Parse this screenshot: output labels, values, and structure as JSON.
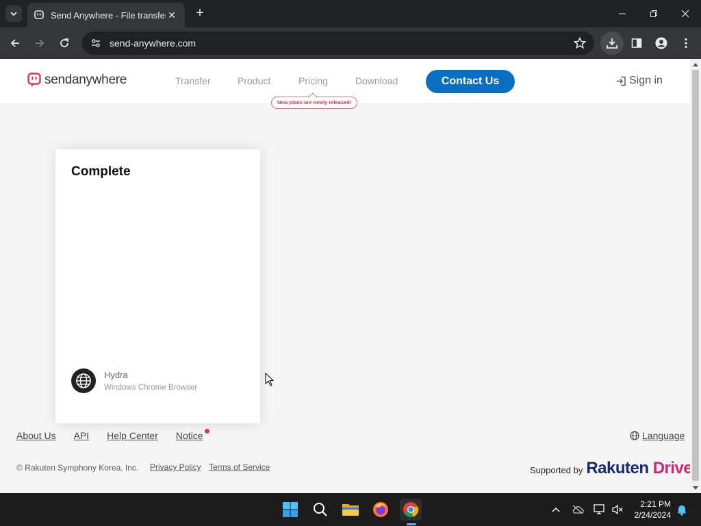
{
  "browser": {
    "tab_title": "Send Anywhere - File transfer",
    "url": "send-anywhere.com"
  },
  "header": {
    "logo_text_bold": "send",
    "logo_text_rest": "anywhere",
    "nav": [
      "Transfer",
      "Product",
      "Pricing",
      "Download"
    ],
    "new_plans_badge": "New plans are newly released!",
    "contact_label": "Contact Us",
    "signin_label": "Sign in"
  },
  "card": {
    "title": "Complete",
    "device_name": "Hydra",
    "device_desc": "Windows Chrome Browser"
  },
  "footer": {
    "links": [
      "About Us",
      "API",
      "Help Center",
      "Notice"
    ],
    "language_label": "Language",
    "copyright": "© Rakuten Symphony Korea, Inc.",
    "privacy": "Privacy Policy",
    "terms": "Terms of Service",
    "supported_by": "Supported by",
    "brand_main": "Rakuten ",
    "brand_accent": "Drive"
  },
  "taskbar": {
    "time": "2:21 PM",
    "date": "2/24/2024"
  },
  "colors": {
    "brand_red": "#e0344f",
    "contact_blue": "#0a6fc2"
  }
}
